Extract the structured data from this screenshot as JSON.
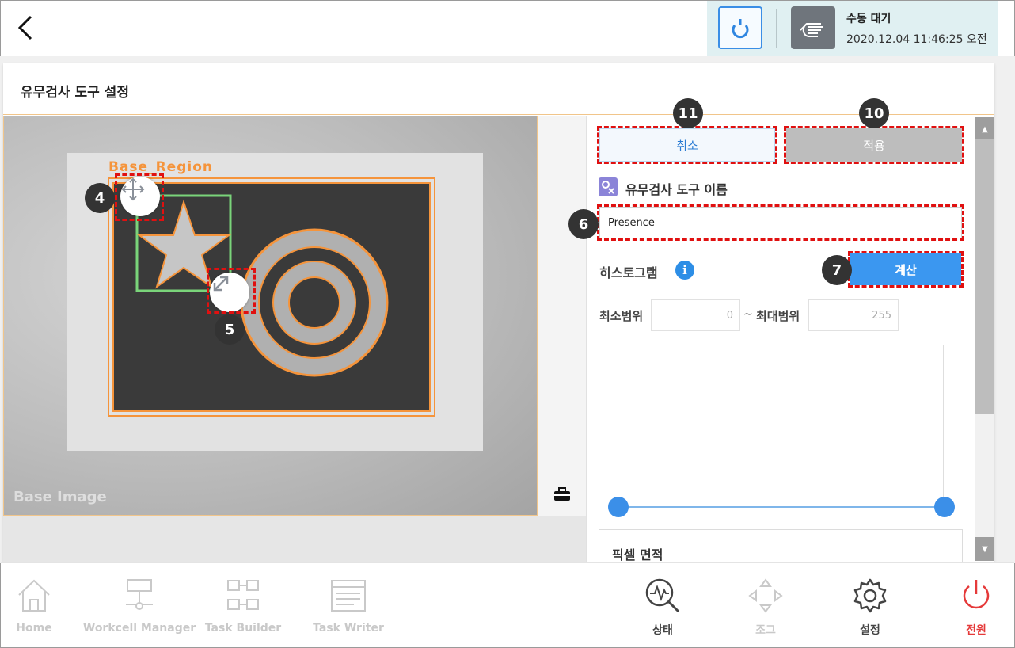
{
  "header": {
    "back_icon": "chevron-left-icon",
    "status_title": "수동 대기",
    "status_time": "2020.12.04 11:46:25 오전",
    "rotate_icon": "refresh-icon",
    "hand_icon": "hand-icon"
  },
  "page": {
    "title": "유무검사 도구 설정"
  },
  "image_view": {
    "region_label": "Base_Region",
    "base_image_label": "Base Image",
    "markers": {
      "move": "4",
      "resize": "5",
      "name": "6",
      "calc": "7",
      "apply": "10",
      "cancel": "11"
    }
  },
  "settings": {
    "cancel_label": "취소",
    "apply_label": "적용",
    "tool_name_label": "유무검사 도구 이름",
    "tool_name_value": "Presence",
    "histogram_label": "히스토그램",
    "info_icon_text": "i",
    "calc_label": "계산",
    "min_label": "최소범위",
    "min_value": "0",
    "tilde": "~",
    "max_label": "최대범위",
    "max_value": "255",
    "pixel_area_label": "픽셀 면적"
  },
  "nav": {
    "home": "Home",
    "workcell_manager": "Workcell Manager",
    "task_builder": "Task Builder",
    "task_writer": "Task Writer",
    "status": "상태",
    "jog": "조그",
    "settings": "설정",
    "power": "전원"
  },
  "colors": {
    "accent_blue": "#3b97f0",
    "region_orange": "#f5943b",
    "power_red": "#e53a3a",
    "marker_red": "#e01010"
  }
}
